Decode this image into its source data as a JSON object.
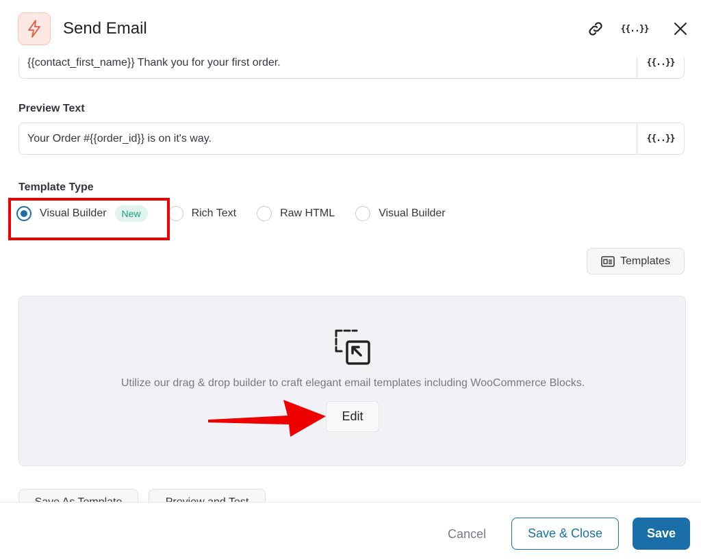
{
  "header": {
    "title": "Send Email",
    "app_icon": "lightning-bolt-icon",
    "merge_tag_label": "{{..}}",
    "icons": [
      "link-icon",
      "merge-tags-icon",
      "close-icon"
    ]
  },
  "subject": {
    "value": "{{contact_first_name}} Thank you for your first order.",
    "merge_label": "{{..}}"
  },
  "preview_text": {
    "label": "Preview Text",
    "value": "Your Order #{{order_id}} is on it's way.",
    "merge_label": "{{..}}"
  },
  "template_type": {
    "label": "Template Type",
    "selected": "Visual Builder",
    "options": [
      {
        "label": "Visual Builder",
        "badge": "New",
        "checked": true
      },
      {
        "label": "Rich Text",
        "checked": false
      },
      {
        "label": "Raw HTML",
        "checked": false
      },
      {
        "label": "Visual Builder",
        "checked": false
      }
    ]
  },
  "templates_button": {
    "label": "Templates",
    "icon": "template-icon"
  },
  "builder": {
    "icon": "drag-drop-icon",
    "description": "Utilize our drag & drop builder to craft elegant email templates including WooCommerce Blocks.",
    "edit_label": "Edit"
  },
  "secondary_actions": {
    "save_as_template": "Save As Template",
    "preview_and_test": "Preview and Test"
  },
  "footer": {
    "cancel_label": "Cancel",
    "save_close_label": "Save & Close",
    "save_label": "Save"
  },
  "colors": {
    "primary": "#1b6fa8",
    "highlight": "#ee0000",
    "badge_bg": "#dff5ee",
    "badge_text": "#1f9e7c",
    "icon_accent": "#e5583f"
  }
}
